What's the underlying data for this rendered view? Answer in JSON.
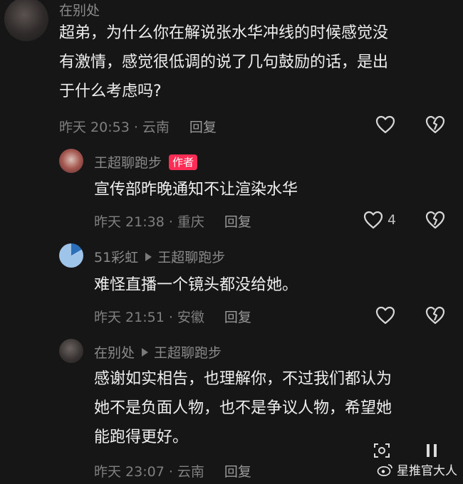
{
  "comments": [
    {
      "author": "在别处",
      "text_lines": [
        "超弟，为什么你在解说张水华冲线的时候感觉没",
        "有激情，感觉很低调的说了几句鼓励的话，是出",
        "于什么考虑吗?"
      ],
      "time": "昨天 20:53 · 云南",
      "reply": "回复"
    },
    {
      "author": "王超聊跑步",
      "badge": "作者",
      "text_lines": [
        "宣传部昨晚通知不让渲染水华"
      ],
      "time": "昨天 21:38 · 重庆",
      "reply": "回复",
      "likes": "4"
    },
    {
      "author": "51彩虹",
      "reply_to": "王超聊跑步",
      "text_lines": [
        "难怪直播一个镜头都没给她。"
      ],
      "time": "昨天 21:51 · 安徽",
      "reply": "回复"
    },
    {
      "author": "在别处",
      "reply_to": "王超聊跑步",
      "text_lines": [
        "感谢如实相告，也理解你，不过我们都认为",
        "她不是负面人物，也不是争议人物，希望她",
        "能跑得更好。"
      ],
      "time": "昨天 23:07 · 云南",
      "reply": "回复"
    }
  ],
  "watermark": "星推官大人",
  "colors": {
    "background": "#161616",
    "badge": "#ff2d55",
    "muted": "#7f7f7f"
  }
}
